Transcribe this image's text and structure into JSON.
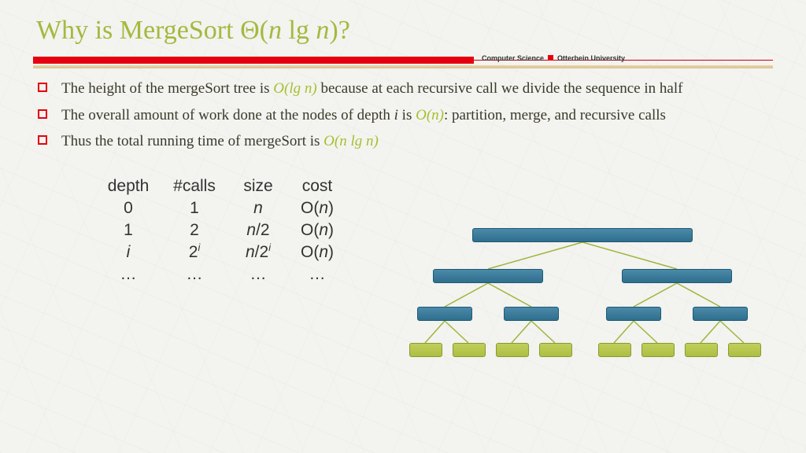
{
  "title_prefix": "Why is MergeSort ",
  "title_theta": "Θ(",
  "title_n": "n",
  "title_lg": " lg ",
  "title_n2": "n",
  "title_close": ")?",
  "header": {
    "cs": "Computer Science",
    "uni": "Otterbein University"
  },
  "bullets": {
    "b1a": "The height of the mergeSort tree is ",
    "b1o": "O",
    "b1p": "(lg ",
    "b1n": "n",
    "b1c": ")",
    "b1b": " because at each recursive call we divide the sequence in half",
    "b2a": "The overall amount of work done at the nodes of depth ",
    "b2i": "i",
    "b2b": " is ",
    "b2o": "O",
    "b2p": "(",
    "b2n": "n",
    "b2c": ")",
    "b2d": ": partition, merge, and recursive calls",
    "b3a": "Thus the total running time of mergeSort is ",
    "b3o": "O",
    "b3p": "(",
    "b3n": "n",
    "b3lg": " lg ",
    "b3n2": "n",
    "b3c": ")"
  },
  "table": {
    "h1": "depth",
    "h2": "#calls",
    "h3": "size",
    "h4": "cost",
    "r1c1": "0",
    "r1c2": "1",
    "r1c3": "n",
    "r1c4a": "O(",
    "r1c4b": "n",
    "r1c4c": ")",
    "r2c1": "1",
    "r2c2": "2",
    "r2c3a": "n",
    "r2c3b": "/2",
    "r2c4a": "O(",
    "r2c4b": "n",
    "r2c4c": ")",
    "r3c1": "i",
    "r3c2a": "2",
    "r3c2b": "i",
    "r3c3a": "n",
    "r3c3b": "/2",
    "r3c3c": "i",
    "r3c4a": "O(",
    "r3c4b": "n",
    "r3c4c": ")",
    "dots": "…"
  }
}
